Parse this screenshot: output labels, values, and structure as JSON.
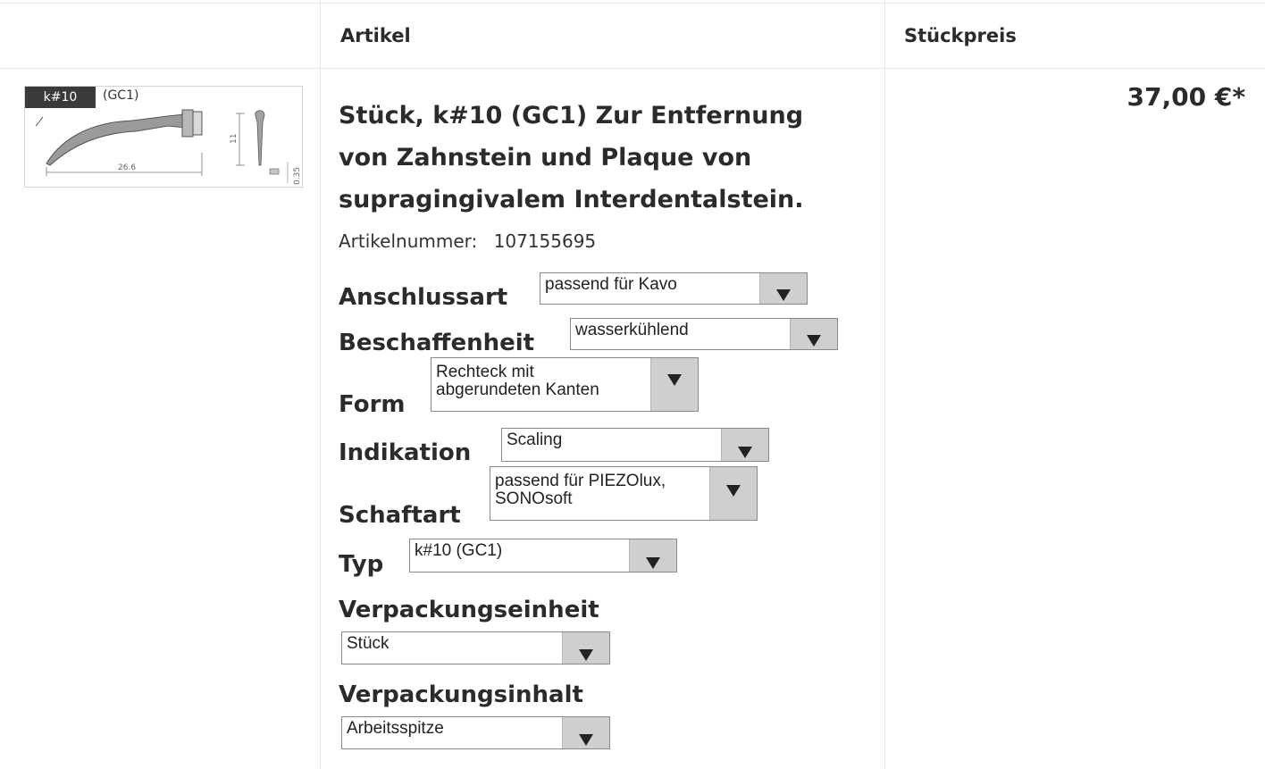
{
  "table": {
    "header": {
      "article_col": "Artikel",
      "price_col": "Stückpreis"
    }
  },
  "product": {
    "image": {
      "tag": "k#10",
      "code": "(GC1)",
      "dim_length": "26.6",
      "dim_height": "11",
      "dim_thickness": "0.35"
    },
    "title": "Stück, k#10 (GC1) Zur Entfernung von Zahnstein und Plaque von supragingivalem Interdentalstein.",
    "article_number_label": "Artikelnummer:",
    "article_number": "107155695",
    "price": "37,00 €*"
  },
  "options": {
    "anschlussart": {
      "label": "Anschlussart",
      "value": "passend für Kavo"
    },
    "beschaffenheit": {
      "label": "Beschaffenheit",
      "value": "wasserkühlend"
    },
    "form": {
      "label": "Form",
      "value_line1": "Rechteck mit",
      "value_line2": "abgerundeten Kanten"
    },
    "indikation": {
      "label": "Indikation",
      "value": "Scaling"
    },
    "schaftart": {
      "label": "Schaftart",
      "value_line1": "passend für PIEZOlux,",
      "value_line2": "SONOsoft"
    },
    "typ": {
      "label": "Typ",
      "value": "k#10 (GC1)"
    },
    "verpackungseinheit": {
      "label": "Verpackungseinheit",
      "value": "Stück"
    },
    "verpackungsinhalt": {
      "label": "Verpackungsinhalt",
      "value": "Arbeitsspitze"
    }
  },
  "icons": {
    "dropdown": "triangle-down-icon"
  }
}
